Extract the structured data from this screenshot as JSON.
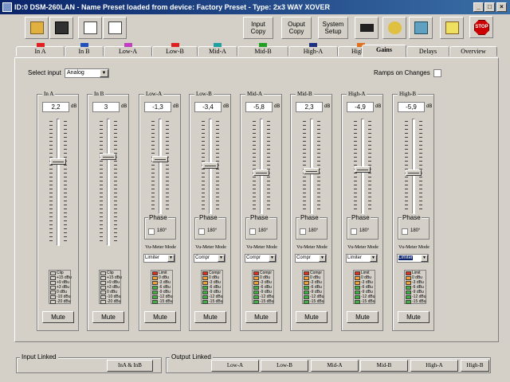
{
  "window": {
    "title": "ID:0 DSM-260LAN - Name Preset loaded from device: Factory Preset - Type: 2x3 WAY XOVER",
    "min": "_",
    "max": "□",
    "close": "×"
  },
  "toolbar": {
    "buttons": [
      {
        "name": "open-folder-icon",
        "color": "#e0b040"
      },
      {
        "name": "save-disk-icon",
        "color": "#303030"
      },
      {
        "name": "print-icon",
        "color": "#606060"
      },
      {
        "name": "print-preview-icon",
        "color": "#606060"
      }
    ],
    "input_copy": "Input Copy",
    "output_copy": "Ouput Copy",
    "system_setup": "System Setup",
    "stop": "STOP"
  },
  "tabs": [
    {
      "label": "In A",
      "marker": "#e02020"
    },
    {
      "label": "In B",
      "marker": "#2050c0"
    },
    {
      "label": "Low-A",
      "marker": "#c040c0"
    },
    {
      "label": "Low-B",
      "marker": "#e02020"
    },
    {
      "label": "Mid-A",
      "marker": "#20a0a0"
    },
    {
      "label": "Mid-B",
      "marker": "#20a020"
    },
    {
      "label": "High-A",
      "marker": "#203080"
    },
    {
      "label": "High-B",
      "marker": "#e07020"
    },
    {
      "label": "Gains",
      "marker": ""
    },
    {
      "label": "Delays",
      "marker": ""
    },
    {
      "label": "Overview",
      "marker": ""
    }
  ],
  "select_input": {
    "label": "Select input",
    "value": "Analog"
  },
  "ramps": {
    "label": "Ramps on Changes"
  },
  "common": {
    "db": "dB",
    "phase": "Phase",
    "deg": "180°",
    "vm_label": "Vu-Meter Mode",
    "mute": "Mute"
  },
  "channels": [
    {
      "name": "In A",
      "gain": "2,2",
      "level": 0.67,
      "type": "input",
      "meter": [
        "Clip",
        "+15 dBu",
        "+9 dBu",
        "+3 dBu",
        "0 dBu",
        "-10 dBu",
        "-20 dBu"
      ]
    },
    {
      "name": "In B",
      "gain": "3",
      "level": 0.71,
      "type": "input",
      "meter": [
        "Clip",
        "+15 dBu",
        "+9 dBu",
        "+3 dBu",
        "0 dBu",
        "-10 dBu",
        "-20 dBu"
      ]
    },
    {
      "name": "Low-A",
      "gain": "-1,3",
      "level": 0.58,
      "type": "output",
      "mode": "Limiter",
      "meter": [
        "Limit",
        "0 dBu",
        "-3 dBu",
        "-6 dBu",
        "-9 dBu",
        "-12 dBu",
        "-15 dBu"
      ]
    },
    {
      "name": "Low-B",
      "gain": "-3,4",
      "level": 0.51,
      "type": "output",
      "mode": "Compr",
      "meter": [
        "Compr",
        "0 dBu",
        "-3 dBu",
        "-6 dBu",
        "-9 dBu",
        "-12 dBu",
        "-15 dBu"
      ]
    },
    {
      "name": "Mid-A",
      "gain": "-5,8",
      "level": 0.43,
      "type": "output",
      "mode": "Compr",
      "meter": [
        "Compr",
        "0 dBu",
        "-3 dBu",
        "-6 dBu",
        "-9 dBu",
        "-12 dBu",
        "-15 dBu"
      ]
    },
    {
      "name": "Mid-B",
      "gain": "2,3",
      "level": 0.45,
      "type": "output",
      "mode": "Compr",
      "meter": [
        "Compr",
        "0 dBu",
        "-3 dBu",
        "-6 dBu",
        "-9 dBu",
        "-12 dBu",
        "-15 dBu"
      ]
    },
    {
      "name": "High-A",
      "gain": "-4,9",
      "level": 0.46,
      "type": "output",
      "mode": "Limiter",
      "meter": [
        "Limit",
        "0 dBu",
        "-3 dBu",
        "-6 dBu",
        "-9 dBu",
        "-12 dBu",
        "-15 dBu"
      ]
    },
    {
      "name": "High-B",
      "gain": "-5,9",
      "level": 0.43,
      "type": "output",
      "mode": "Limiter",
      "meter": [
        "Limit",
        "0 dBu",
        "-3 dBu",
        "-6 dBu",
        "-9 dBu",
        "-12 dBu",
        "-15 dBu"
      ]
    }
  ],
  "input_linked": {
    "label": "Input Linked",
    "button": "InA & InB"
  },
  "output_linked": {
    "label": "Output Linked",
    "buttons": [
      "Low-A",
      "Low-B",
      "Mid-A",
      "Mid-B",
      "High-A",
      "High-B"
    ]
  },
  "colors": {
    "led_top": "#e03020",
    "led_mid": "#f0a030",
    "led_low": "#40b040"
  }
}
